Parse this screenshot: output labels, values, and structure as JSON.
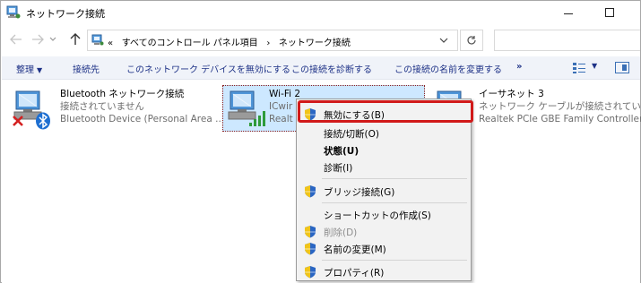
{
  "window": {
    "title": "ネットワーク接続"
  },
  "address_bar": {
    "chevron": "«",
    "path": [
      "すべてのコントロール パネル項目",
      "ネットワーク接続"
    ],
    "separator": "›"
  },
  "toolbar": {
    "organize": "整理",
    "connect_to": "接続先",
    "disable_device": "このネットワーク デバイスを無効にする",
    "diagnose": "この接続を診断する",
    "rename": "この接続の名前を変更する",
    "more": "»"
  },
  "adapters": [
    {
      "name": "Bluetooth ネットワーク接続",
      "status": "接続されていません",
      "device": "Bluetooth Device (Personal Area ..."
    },
    {
      "name": "Wi-Fi 2",
      "status": "ICwir",
      "device": "Realt"
    },
    {
      "name": "イーサネット 3",
      "status": "ネットワーク ケーブルが接続されていま...",
      "device": "Realtek PCIe GBE Family Controller"
    }
  ],
  "context_menu": {
    "items": [
      {
        "label": "無効にする(B)",
        "shield": true
      },
      {
        "label": "接続/切断(O)",
        "shield": false
      },
      {
        "label": "状態(U)",
        "shield": false
      },
      {
        "label": "診断(I)",
        "shield": false
      },
      {
        "label": "ブリッジ接続(G)",
        "shield": true
      },
      {
        "label": "ショートカットの作成(S)",
        "shield": false
      },
      {
        "label": "削除(D)",
        "shield": true
      },
      {
        "label": "名前の変更(M)",
        "shield": true
      },
      {
        "label": "プロパティ(R)",
        "shield": true
      }
    ]
  },
  "colors": {
    "selection": "#cde8ff",
    "highlight_box": "#d11a1a",
    "command_text": "#1e3287"
  }
}
